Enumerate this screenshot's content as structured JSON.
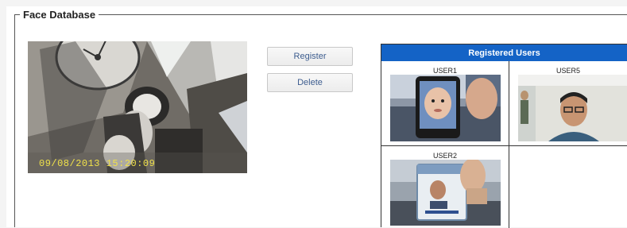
{
  "section": {
    "title": "Face Database"
  },
  "camera": {
    "timestamp": "09/08/2013  15:20:09"
  },
  "buttons": {
    "register": "Register",
    "delete": "Delete"
  },
  "registered": {
    "header": "Registered Users",
    "users": [
      {
        "name": "USER1"
      },
      {
        "name": "USER5"
      },
      {
        "name": "USER2"
      }
    ]
  },
  "colors": {
    "header_bg": "#1463c6",
    "button_text": "#3d5d8f",
    "timestamp": "#f1e24a"
  }
}
